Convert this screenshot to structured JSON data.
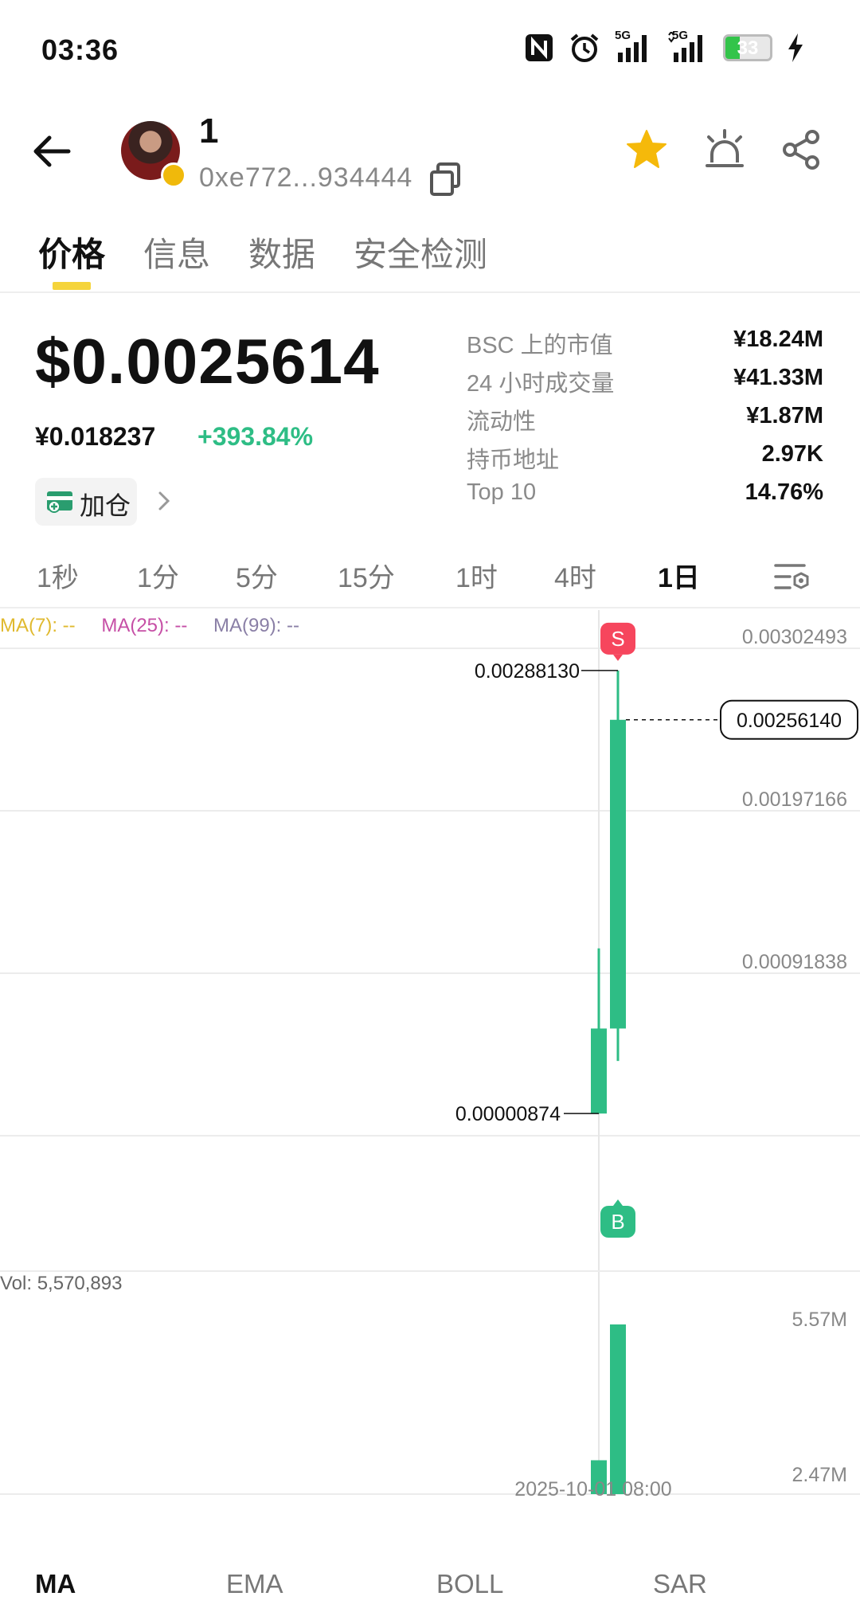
{
  "status_bar": {
    "time": "03:36",
    "icons": [
      "nfc-icon",
      "alarm-icon",
      "signal-5g-icon",
      "signal-5g-icon"
    ],
    "net_label_1": "5G",
    "net_label_2": "5G",
    "battery_level": 33,
    "battery_text": "33",
    "charging": true
  },
  "header": {
    "token_name": "1",
    "address": "0xe772...934444",
    "favorite": true
  },
  "tabs": [
    "价格",
    "信息",
    "数据",
    "安全检测"
  ],
  "active_tab": 0,
  "price": {
    "usd": "$0.0025614",
    "cny": "¥0.018237",
    "change": "+393.84%",
    "add_label": "加仓"
  },
  "stats": [
    {
      "label": "BSC 上的市值",
      "value": "¥18.24M"
    },
    {
      "label": "24 小时成交量",
      "value": "¥41.33M"
    },
    {
      "label": "流动性",
      "value": "¥1.87M"
    },
    {
      "label": "持币地址",
      "value": "2.97K"
    },
    {
      "label": "Top 10",
      "value": "14.76%"
    }
  ],
  "intervals": [
    "1秒",
    "1分",
    "5分",
    "15分",
    "1时",
    "4时",
    "1日"
  ],
  "active_interval": 6,
  "chart": {
    "ma7": "MA(7): --",
    "ma25": "MA(25): --",
    "ma99": "MA(99): --",
    "vol_label": "Vol: 5,570,893",
    "x_label": "2025-10-01 08:00"
  },
  "chart_data": {
    "type": "candlestick",
    "y_ticks": [
      "0.00302493",
      "0.00197166",
      "0.00091838"
    ],
    "y_tick_values": [
      0.00302493,
      0.00197166,
      0.00091838
    ],
    "high_label": "0.00288130",
    "low_label": "0.00000874",
    "current_label": "0.00256140",
    "candles": [
      {
        "open": 8.74e-06,
        "close": 0.00056,
        "high": 0.00108,
        "low": 8.74e-06
      },
      {
        "open": 0.00056,
        "close": 0.0025614,
        "high": 0.0028813,
        "low": 0.00035
      }
    ],
    "volume_ticks": [
      "5.57M",
      "2.47M"
    ],
    "volume_tick_values": [
      5.57,
      2.47
    ],
    "volumes": [
      2.86,
      5.570893
    ],
    "markers": [
      {
        "label": "S",
        "color": "#f6465d"
      },
      {
        "label": "B",
        "color": "#2ebd85"
      }
    ],
    "colors": {
      "up": "#2ebd85",
      "grid": "#ececec",
      "ma7": "#e0b92e",
      "ma25": "#c64fa6",
      "ma99": "#8a7fa6"
    }
  },
  "indicators": [
    "MA",
    "EMA",
    "BOLL",
    "SAR"
  ],
  "active_indicator": 0
}
